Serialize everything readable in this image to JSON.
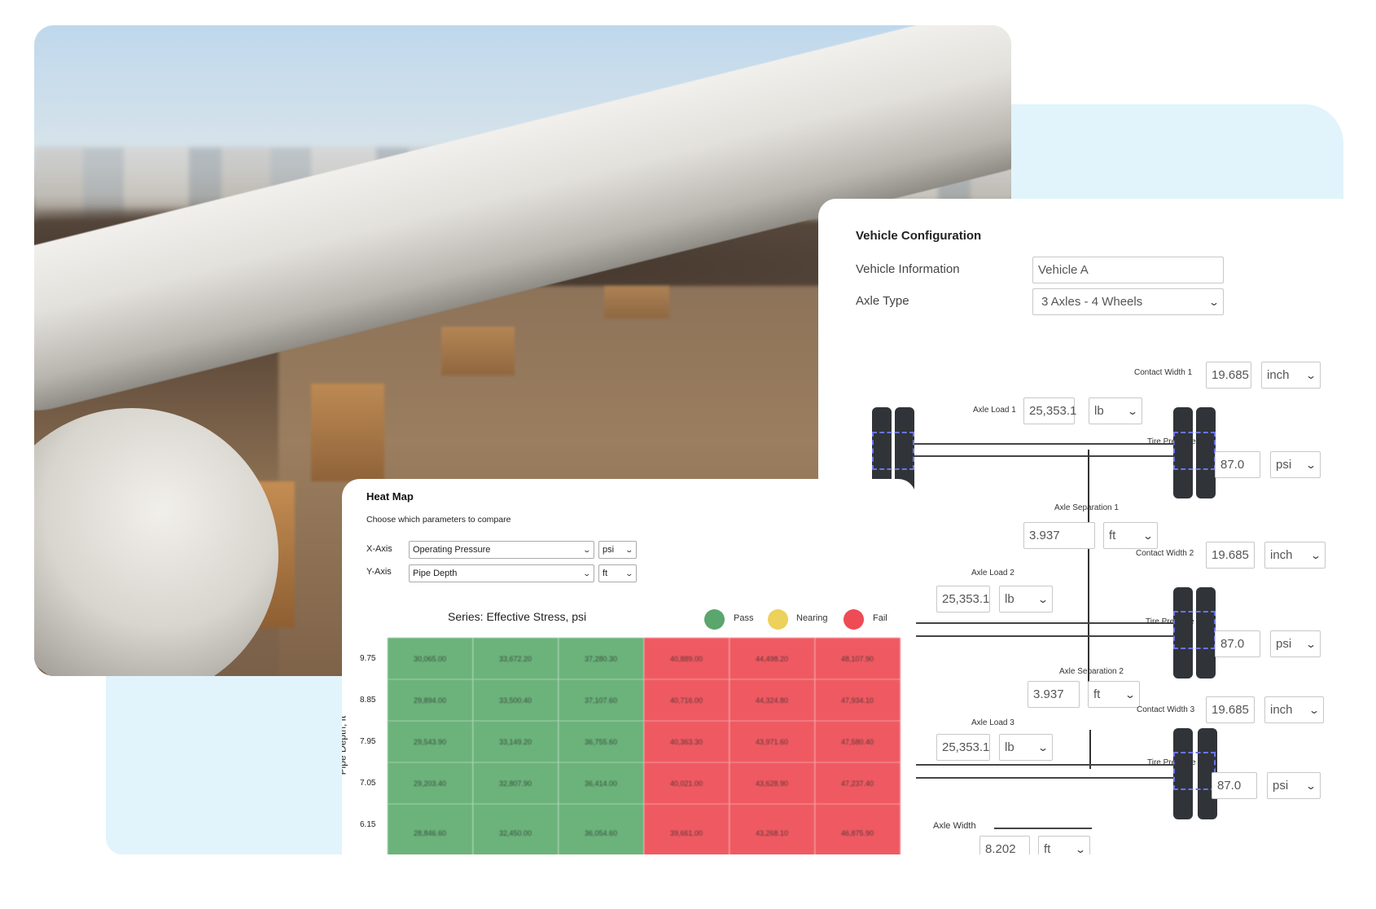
{
  "heatmap": {
    "title": "Heat Map",
    "subtitle": "Choose which parameters to compare",
    "x_axis": {
      "label": "X-Axis",
      "parameter": "Operating Pressure",
      "unit": "psi"
    },
    "y_axis": {
      "label": "Y-Axis",
      "parameter": "Pipe Depth",
      "unit": "ft"
    },
    "series_title": "Series: Effective Stress, psi",
    "y_axis_title": "Pipe Depth, ft",
    "legend": [
      {
        "label": "Pass",
        "color": "#5aa66c"
      },
      {
        "label": "Nearing",
        "color": "#ecd15a"
      },
      {
        "label": "Fail",
        "color": "#ee4b55"
      }
    ],
    "colors": {
      "pass_cell": "#6bb37b",
      "fail_cell": "#ef5a62"
    }
  },
  "chart_data": {
    "type": "heatmap",
    "title": "Series: Effective Stress, psi",
    "ylabel": "Pipe Depth, ft",
    "xlabel": "",
    "y": [
      "9.75",
      "8.85",
      "7.95",
      "7.05",
      "6.15"
    ],
    "values": [
      [
        "30,065.00",
        "33,672.20",
        "37,280.30",
        "40,889.00",
        "44,498.20",
        "48,107.90"
      ],
      [
        "29,894.00",
        "33,500.40",
        "37,107.60",
        "40,716.00",
        "44,324.80",
        "47,934.10"
      ],
      [
        "29,543.90",
        "33,149.20",
        "36,755.60",
        "40,363.30",
        "43,971.60",
        "47,580.40"
      ],
      [
        "29,203.40",
        "32,807.90",
        "36,414.00",
        "40,021.00",
        "43,628.90",
        "47,237.40"
      ],
      [
        "28,846.60",
        "32,450.00",
        "36,054.60",
        "39,661.00",
        "43,268.10",
        "46,875.90"
      ]
    ],
    "status": [
      [
        "Pass",
        "Pass",
        "Pass",
        "Fail",
        "Fail",
        "Fail"
      ],
      [
        "Pass",
        "Pass",
        "Pass",
        "Fail",
        "Fail",
        "Fail"
      ],
      [
        "Pass",
        "Pass",
        "Pass",
        "Fail",
        "Fail",
        "Fail"
      ],
      [
        "Pass",
        "Pass",
        "Pass",
        "Fail",
        "Fail",
        "Fail"
      ],
      [
        "Pass",
        "Pass",
        "Pass",
        "Fail",
        "Fail",
        "Fail"
      ]
    ],
    "legend": [
      "Pass",
      "Nearing",
      "Fail"
    ],
    "legend_position": "top-right"
  },
  "vehicle": {
    "title": "Vehicle Configuration",
    "info_label": "Vehicle Information",
    "info_value": "Vehicle A",
    "axle_type_label": "Axle Type",
    "axle_type_value": "3 Axles - 4 Wheels",
    "axles": [
      {
        "contact_width_label": "Contact Width 1",
        "contact_width": "19.685",
        "contact_width_unit": "inch",
        "axle_load_label": "Axle Load 1",
        "axle_load": "25,353.1",
        "axle_load_unit": "lb",
        "tire_pressure_label": "Tire Pressure 1",
        "tire_pressure": "87.0",
        "tire_pressure_unit": "psi"
      },
      {
        "contact_width_label": "Contact Width 2",
        "contact_width": "19.685",
        "contact_width_unit": "inch",
        "axle_load_label": "Axle Load 2",
        "axle_load": "25,353.1",
        "axle_load_unit": "lb",
        "tire_pressure_label": "Tire Pressure 2",
        "tire_pressure": "87.0",
        "tire_pressure_unit": "psi"
      },
      {
        "contact_width_label": "Contact Width 3",
        "contact_width": "19.685",
        "contact_width_unit": "inch",
        "axle_load_label": "Axle Load 3",
        "axle_load": "25,353.1",
        "axle_load_unit": "lb",
        "tire_pressure_label": "Tire Pressure 3",
        "tire_pressure": "87.0",
        "tire_pressure_unit": "psi"
      }
    ],
    "separations": [
      {
        "label": "Axle Separation 1",
        "value": "3.937",
        "unit": "ft"
      },
      {
        "label": "Axle Separation 2",
        "value": "3.937",
        "unit": "ft"
      }
    ],
    "axle_width": {
      "label": "Axle Width",
      "value": "8.202",
      "unit": "ft"
    },
    "colors": {
      "tire": "#303438",
      "contact_patch": "#6b74e8"
    }
  },
  "chevron": "❯"
}
